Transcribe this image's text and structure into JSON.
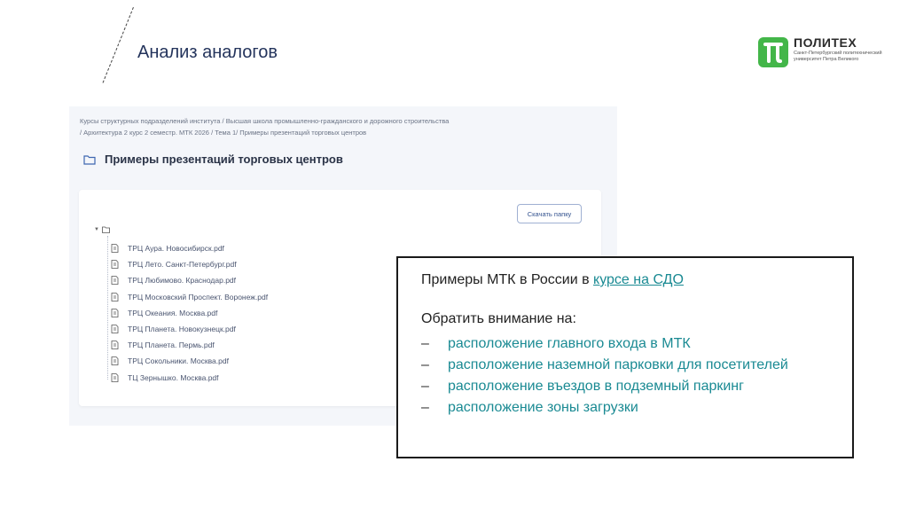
{
  "slide": {
    "title": "Анализ аналогов"
  },
  "logo": {
    "name": "ПОЛИТЕХ",
    "subtitle": "Санкт-Петербургский политехнический университет Петра Великого",
    "brand_color": "#43b649"
  },
  "screenshot": {
    "breadcrumb_line1": "Курсы структурных подразделений института / Высшая школа промышленно-гражданского и дорожного строительства",
    "breadcrumb_line2": "/ Архитектура 2 курс 2 семестр. МТК 2026 / Тема 1/ Примеры презентаций торговых центров",
    "folder_title": "Примеры презентаций торговых центров",
    "folder_icon": "folder-icon",
    "download_button": "Скачать папку",
    "files": [
      "ТРЦ Аура. Новосибирск.pdf",
      "ТРЦ Лето. Санкт-Петербург.pdf",
      "ТРЦ Любимово. Краснодар.pdf",
      "ТРЦ Московский Проспект. Воронеж.pdf",
      "ТРЦ Океания. Москва.pdf",
      "ТРЦ Планета. Новокузнецк.pdf",
      "ТРЦ Планета. Пермь.pdf",
      "ТРЦ Сокольники. Москва.pdf",
      "ТЦ Зернышко. Москва.pdf"
    ]
  },
  "info": {
    "intro_text": "Примеры МТК в России в ",
    "intro_link": "курсе на СДО",
    "attention_text": "Обратить внимание на:",
    "dash": "–",
    "bullets": [
      "расположение главного входа в МТК",
      "расположение наземной парковки для посетителей",
      "расположение въездов в подземный паркинг",
      "расположение зоны загрузки"
    ],
    "accent_color": "#1a8a93"
  }
}
